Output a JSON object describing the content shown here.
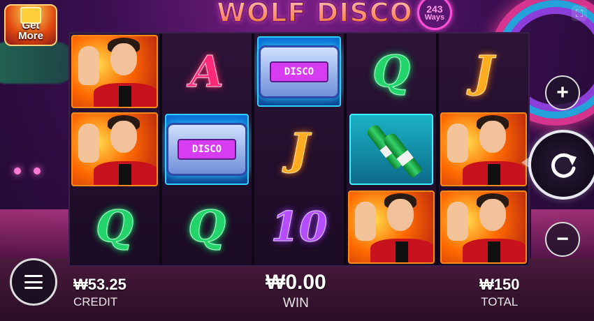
{
  "game": {
    "title": "WOLF DISCO",
    "ways_number": "243",
    "ways_label": "Ways"
  },
  "promo": {
    "label_line1": "Get",
    "label_line2": "More"
  },
  "reels": [
    [
      "wild",
      "wild",
      "Q"
    ],
    [
      "A",
      "pager",
      "Q"
    ],
    [
      "pager",
      "J",
      "10"
    ],
    [
      "Q",
      "bottles",
      "wild"
    ],
    [
      "J",
      "wild",
      "wild"
    ]
  ],
  "symbols": {
    "pager_screen_text": "DISCO"
  },
  "letter_colors": {
    "Q": "green",
    "A": "pink",
    "J": "orange",
    "10": "purple"
  },
  "status": {
    "credit_value": "₩53.25",
    "credit_label": "CREDIT",
    "win_value": "₩0.00",
    "win_label": "WIN",
    "total_value": "₩150",
    "total_label": "TOTAL"
  },
  "controls": {
    "plus": "+",
    "minus": "−"
  }
}
